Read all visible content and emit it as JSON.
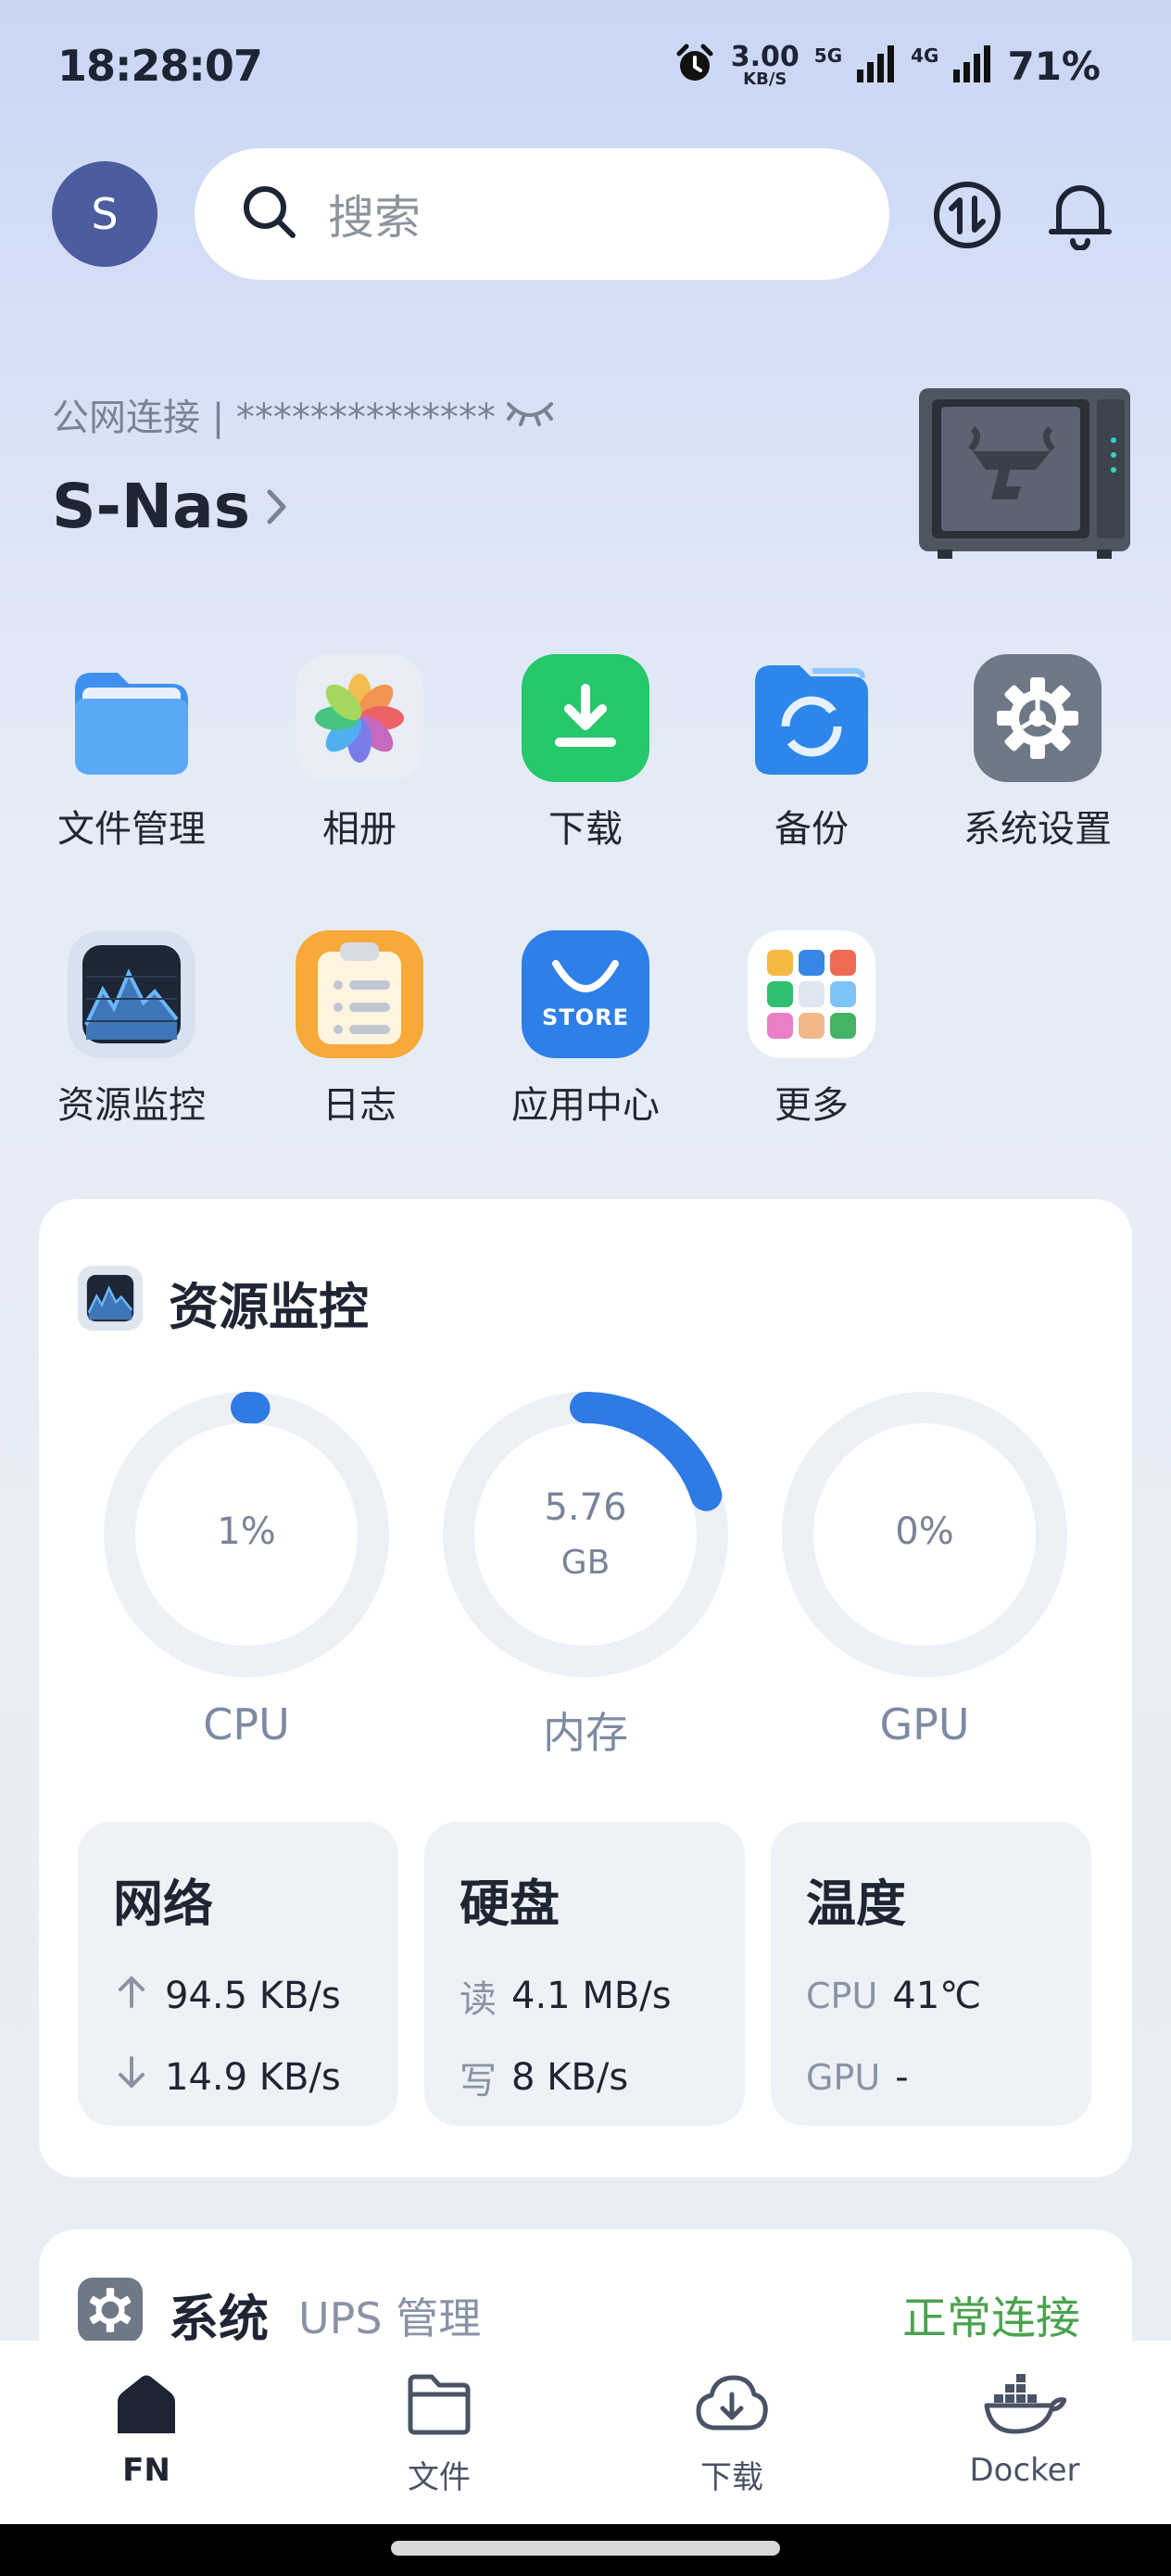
{
  "status_bar": {
    "time": "18:28:07",
    "net_speed_value": "3.00",
    "net_speed_unit": "KB/S",
    "sim1_label": "5G",
    "sim2_label": "4G",
    "battery": "71%"
  },
  "header": {
    "avatar_letter": "S",
    "search_placeholder": "搜索"
  },
  "device": {
    "connection": "公网连接 | **************",
    "name": "S-Nas"
  },
  "apps": [
    {
      "label": "文件管理",
      "icon": "folder-icon"
    },
    {
      "label": "相册",
      "icon": "photos-icon"
    },
    {
      "label": "下载",
      "icon": "download-icon"
    },
    {
      "label": "备份",
      "icon": "backup-icon"
    },
    {
      "label": "系统设置",
      "icon": "gear-icon"
    },
    {
      "label": "资源监控",
      "icon": "monitor-icon"
    },
    {
      "label": "日志",
      "icon": "log-icon"
    },
    {
      "label": "应用中心",
      "icon": "store-icon"
    },
    {
      "label": "更多",
      "icon": "more-apps-icon"
    }
  ],
  "store_icon_text": "STORE",
  "monitor": {
    "title": "资源监控",
    "gauges": [
      {
        "label": "CPU",
        "value": "1%",
        "fraction": 0.01
      },
      {
        "label": "内存",
        "value": "5.76",
        "unit": "GB",
        "fraction": 0.2
      },
      {
        "label": "GPU",
        "value": "0%",
        "fraction": 0
      }
    ],
    "network": {
      "title": "网络",
      "up": "94.5 KB/s",
      "down": "14.9 KB/s"
    },
    "disk": {
      "title": "硬盘",
      "read_label": "读",
      "read": "4.1 MB/s",
      "write_label": "写",
      "write": "8 KB/s"
    },
    "temperature": {
      "title": "温度",
      "cpu_label": "CPU",
      "cpu": "41℃",
      "gpu_label": "GPU",
      "gpu": "-"
    }
  },
  "system": {
    "title": "系统",
    "subtitle": "UPS 管理",
    "status": "正常连接"
  },
  "nav": [
    {
      "label": "FN",
      "icon": "home-icon",
      "active": true
    },
    {
      "label": "文件",
      "icon": "folder-outline-icon",
      "active": false
    },
    {
      "label": "下载",
      "icon": "cloud-download-icon",
      "active": false
    },
    {
      "label": "Docker",
      "icon": "docker-icon",
      "active": false
    }
  ],
  "colors": {
    "accent_blue": "#2f7be5",
    "ring_track": "#edf0f5",
    "status_green": "#4aa24d",
    "avatar_bg": "#4c5c9e"
  }
}
